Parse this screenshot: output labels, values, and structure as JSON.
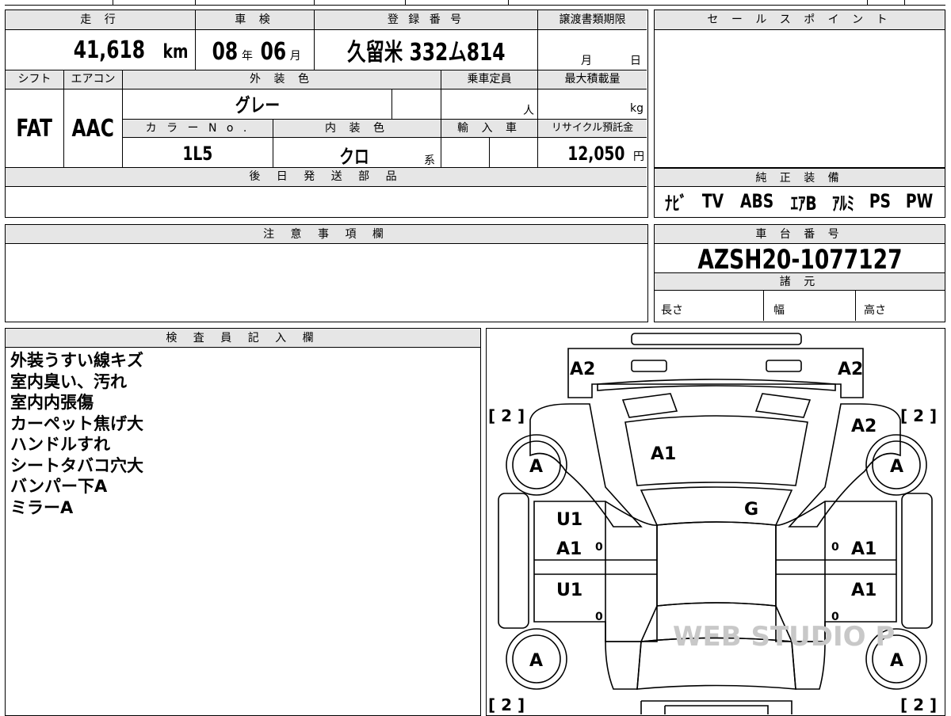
{
  "basic": {
    "mileage_label": "走 行",
    "mileage_value": "41,618",
    "mileage_unit": "km",
    "shaken_label": "車 検",
    "shaken_year": "08",
    "shaken_year_unit": "年",
    "shaken_month": "06",
    "shaken_month_unit": "月",
    "plate_label": "登 録 番 号",
    "plate_value": "久留米 332ム814",
    "transfer_label": "譲渡書類期限",
    "transfer_month_unit": "月",
    "transfer_day_unit": "日"
  },
  "spec": {
    "shift_label": "シフト",
    "shift_value": "FAT",
    "aircon_label": "エアコン",
    "aircon_value": "AAC",
    "exterior_label": "外 装 色",
    "exterior_value": "グレー",
    "capacity_label": "乗車定員",
    "capacity_unit": "人",
    "maxload_label": "最大積載量",
    "maxload_unit": "kg",
    "color_no_label": "カ ラ ー N o .",
    "color_no_value": "1L5",
    "interior_label": "内 装 色",
    "interior_value": "クロ",
    "interior_suffix": "系",
    "import_label": "輸 入 車",
    "recycle_label": "リサイクル預託金",
    "recycle_value": "12,050",
    "recycle_unit": "円",
    "later_parts_label": "後 日 発 送 部 品"
  },
  "sales_point": {
    "label": "セ ー ル ス ポ イ ン ト"
  },
  "equipment": {
    "label": "純 正 装 備",
    "items": [
      "ﾅﾋﾞ",
      "TV",
      "ABS",
      "ｴｱB",
      "ｱﾙﾐ",
      "PS",
      "PW"
    ]
  },
  "caution": {
    "label": "注 意 事 項 欄"
  },
  "chassis": {
    "label": "車 台 番 号",
    "value": "AZSH20-1077127",
    "specs_label": "諸 元",
    "length_label": "長さ",
    "width_label": "幅",
    "height_label": "高さ"
  },
  "inspector": {
    "label": "検 査 員 記 入 欄",
    "notes": [
      "外装うすい線キズ",
      "室内臭い、汚れ",
      "室内内張傷",
      "カーペット焦げ大",
      "ハンドルすれ",
      "シートタバコ穴大",
      "バンパー下A",
      "ミラーA"
    ]
  },
  "diagram": {
    "marks": {
      "front_left": "A2",
      "front_right": "A2",
      "right_fender": "A2",
      "hood": "A1",
      "windshield": "G",
      "left_front_door_1": "U1",
      "left_front_door_2": "A1",
      "right_front_door": "A1",
      "left_rear_door": "U1",
      "right_rear_door": "A1",
      "tire_fl": "A",
      "tire_fr": "A",
      "tire_rl": "A",
      "tire_rr": "A",
      "tire_tread_fl": "[ 2 ]",
      "tire_tread_fr": "[ 2 ]",
      "tire_tread_rl": "[ 2 ]",
      "tire_tread_rr": "[ 2 ]",
      "door_zero": "0",
      "watermark": "WEB STUDIO P"
    }
  }
}
